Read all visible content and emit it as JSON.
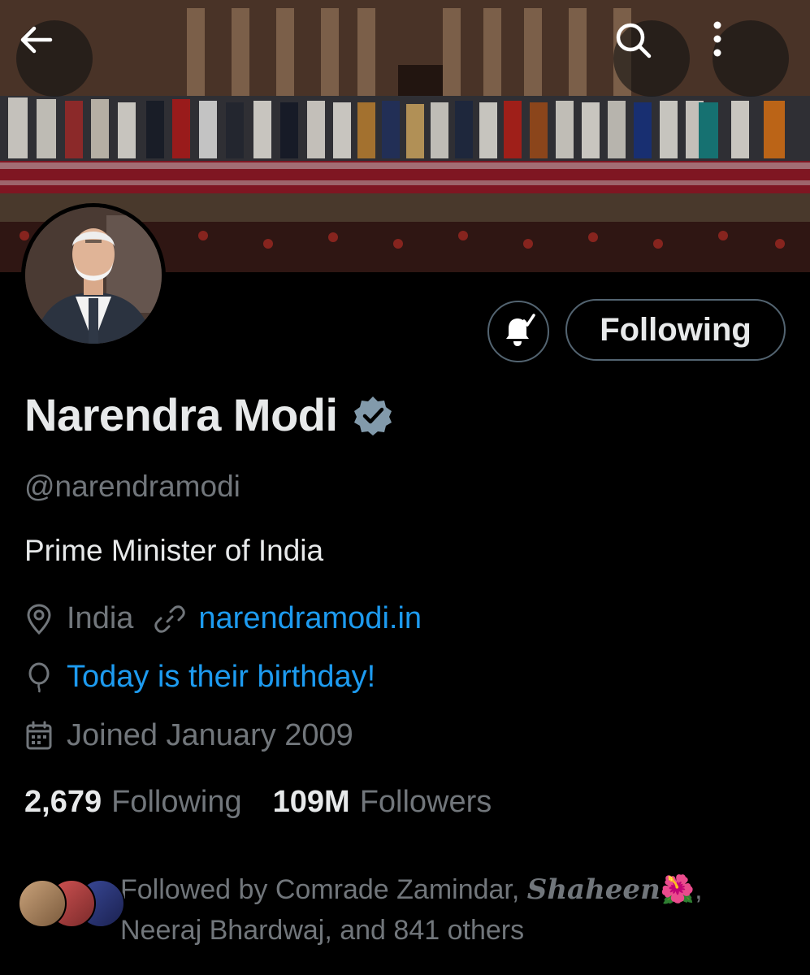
{
  "header": {
    "back_icon": "arrow-left-icon",
    "search_icon": "search-icon",
    "more_icon": "more-vertical-icon"
  },
  "profile": {
    "name": "Narendra Modi",
    "verified_icon": "verified-badge-icon",
    "handle": "@narendramodi",
    "bio": "Prime Minister of India",
    "location": "India",
    "website": "narendramodi.in",
    "birthday": "Today is their birthday!",
    "joined": "Joined January 2009"
  },
  "actions": {
    "notify_icon": "bell-check-icon",
    "follow_label": "Following"
  },
  "stats": {
    "following_count": "2,679",
    "following_label": "Following",
    "followers_count": "109M",
    "followers_label": "Followers"
  },
  "followed_by": {
    "prefix": "Followed by Comrade Zamindar,",
    "highlight_name": "Shaheen",
    "emoji": "🌺",
    "suffix": ",",
    "line2": "Neeraj Bhardwaj, and 841 others"
  },
  "colors": {
    "accent": "#1d9bf0",
    "muted": "#71767b",
    "text": "#e7e9ea",
    "border": "#536471",
    "background": "#000000"
  }
}
